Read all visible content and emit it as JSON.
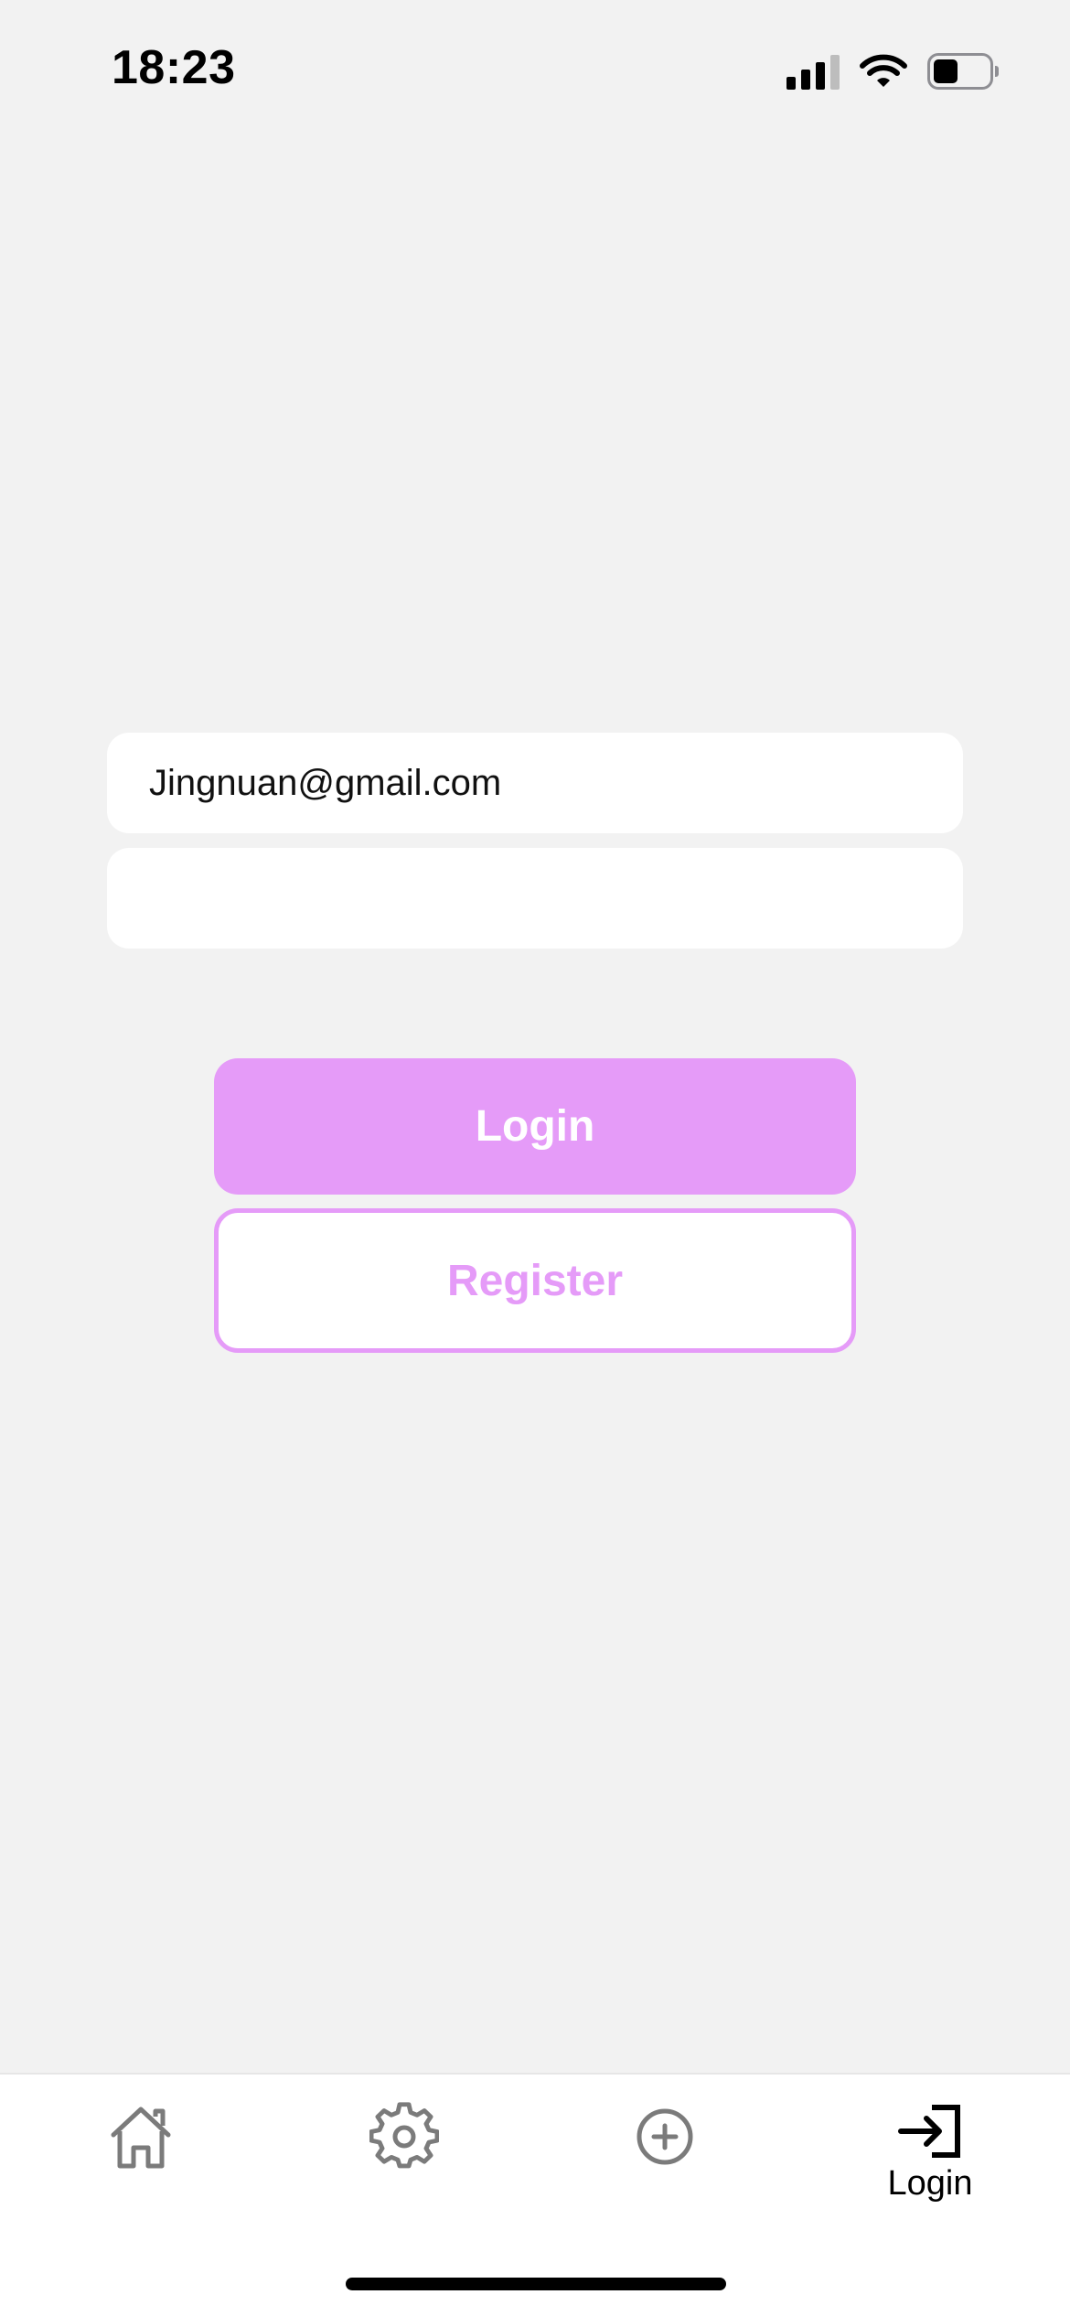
{
  "status_bar": {
    "time": "18:23",
    "icons": [
      "cellular-signal-icon",
      "wifi-icon",
      "battery-icon"
    ]
  },
  "login_form": {
    "email_value": "Jingnuan@gmail.com",
    "password_value": "",
    "login_label": "Login",
    "register_label": "Register"
  },
  "tab_bar": {
    "items": [
      {
        "icon": "home-icon",
        "label": ""
      },
      {
        "icon": "gear-icon",
        "label": ""
      },
      {
        "icon": "add-circle-icon",
        "label": ""
      },
      {
        "icon": "login-icon",
        "label": "Login"
      }
    ]
  },
  "colors": {
    "accent": "#e59bf8",
    "background": "#f2f2f2",
    "tab_inactive": "#7b7b7b"
  }
}
